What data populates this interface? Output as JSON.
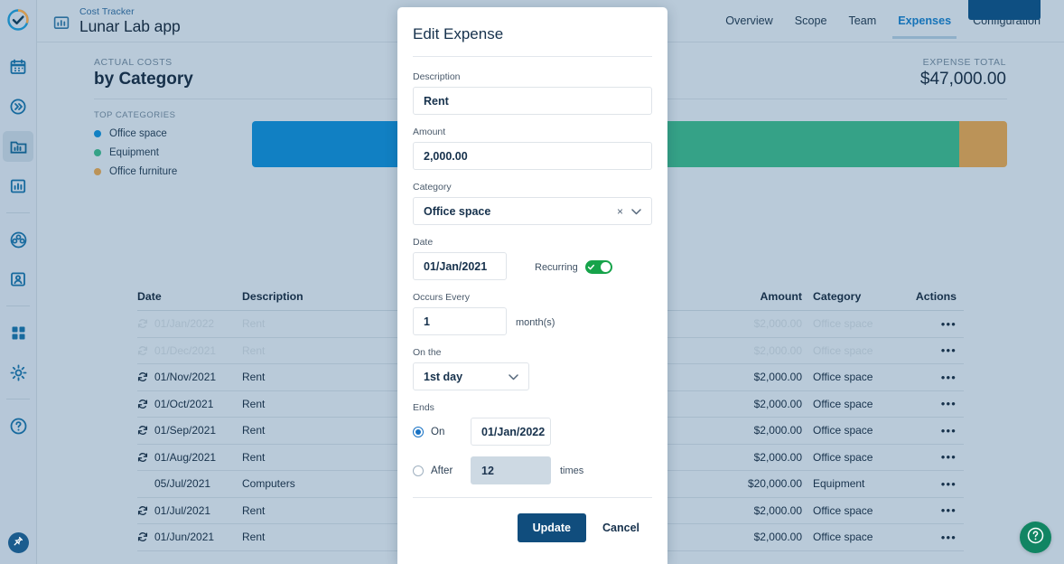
{
  "sidebar": {
    "logo_icon": "check-circle-logo-icon",
    "items": [
      {
        "icon": "calendar-icon",
        "name": "calendar",
        "active": false
      },
      {
        "icon": "chevrons-right-icon",
        "name": "timeline",
        "active": false
      },
      {
        "icon": "folder-chart-icon",
        "name": "projects",
        "active": true
      },
      {
        "icon": "bar-chart-icon",
        "name": "reports",
        "active": false
      },
      {
        "icon": "group-icon",
        "name": "teams",
        "active": false
      },
      {
        "icon": "user-card-icon",
        "name": "resources",
        "active": false
      },
      {
        "icon": "grid-apps-icon",
        "name": "apps",
        "active": false
      },
      {
        "icon": "gear-icon",
        "name": "settings",
        "active": false
      },
      {
        "icon": "question-circle-icon",
        "name": "help",
        "active": false
      }
    ],
    "pin_icon": "pin-icon"
  },
  "header": {
    "app_icon": "chart-folder-icon",
    "breadcrumb": "Cost Tracker",
    "title": "Lunar Lab app",
    "nav": [
      {
        "label": "Overview",
        "active": false
      },
      {
        "label": "Scope",
        "active": false
      },
      {
        "label": "Team",
        "active": false
      },
      {
        "label": "Expenses",
        "active": true
      },
      {
        "label": "Configuration",
        "active": false
      }
    ]
  },
  "chart_panel": {
    "kicker": "ACTUAL COSTS",
    "title": "by Category",
    "total_kicker": "EXPENSE TOTAL",
    "total_value": "$47,000.00",
    "legend_kicker": "TOP CATEGORIES"
  },
  "chart_data": {
    "type": "bar",
    "title": "Actual Costs by Category",
    "orientation": "horizontal-stacked",
    "categories": [
      "Office space",
      "Equipment",
      "Office furniture"
    ],
    "values": [
      24000,
      20000,
      3000
    ],
    "colors": [
      "#1180c3",
      "#35a287",
      "#bb9358"
    ],
    "total": 47000,
    "total_label": "$47,000.00",
    "legend_position": "left",
    "grid": false,
    "xlabel": "",
    "ylabel": ""
  },
  "table": {
    "columns": [
      "Date",
      "Description",
      "Amount",
      "Category",
      "Actions"
    ],
    "actions_glyph": "•••",
    "recurring_icon": "recurring-icon",
    "rows": [
      {
        "date": "01/Jan/2022",
        "description": "Rent",
        "amount": "$2,000.00",
        "category": "Office space",
        "recurring": true,
        "dim": true
      },
      {
        "date": "01/Dec/2021",
        "description": "Rent",
        "amount": "$2,000.00",
        "category": "Office space",
        "recurring": true,
        "dim": true
      },
      {
        "date": "01/Nov/2021",
        "description": "Rent",
        "amount": "$2,000.00",
        "category": "Office space",
        "recurring": true,
        "dim": false
      },
      {
        "date": "01/Oct/2021",
        "description": "Rent",
        "amount": "$2,000.00",
        "category": "Office space",
        "recurring": true,
        "dim": false
      },
      {
        "date": "01/Sep/2021",
        "description": "Rent",
        "amount": "$2,000.00",
        "category": "Office space",
        "recurring": true,
        "dim": false
      },
      {
        "date": "01/Aug/2021",
        "description": "Rent",
        "amount": "$2,000.00",
        "category": "Office space",
        "recurring": true,
        "dim": false
      },
      {
        "date": "05/Jul/2021",
        "description": "Computers",
        "amount": "$20,000.00",
        "category": "Equipment",
        "recurring": false,
        "dim": false
      },
      {
        "date": "01/Jul/2021",
        "description": "Rent",
        "amount": "$2,000.00",
        "category": "Office space",
        "recurring": true,
        "dim": false
      },
      {
        "date": "01/Jun/2021",
        "description": "Rent",
        "amount": "$2,000.00",
        "category": "Office space",
        "recurring": true,
        "dim": false
      }
    ]
  },
  "modal": {
    "title": "Edit Expense",
    "description_label": "Description",
    "description_value": "Rent",
    "amount_label": "Amount",
    "amount_value": "2,000.00",
    "category_label": "Category",
    "category_value": "Office space",
    "category_clear_glyph": "×",
    "category_chevron_glyph": "⌄",
    "date_label": "Date",
    "date_value": "01/Jan/2021",
    "recurring_label": "Recurring",
    "recurring_on": true,
    "occurs_label": "Occurs Every",
    "occurs_value": "1",
    "occurs_unit": "month(s)",
    "onthe_label": "On the",
    "onthe_value": "1st day",
    "onthe_chevron_glyph": "⌄",
    "ends_label": "Ends",
    "ends_on_label": "On",
    "ends_on_value": "01/Jan/2022",
    "ends_after_label": "After",
    "ends_after_value": "12",
    "ends_after_unit": "times",
    "ends_selected": "on",
    "update_label": "Update",
    "cancel_label": "Cancel"
  },
  "fab": {
    "icon": "question-circle-icon"
  },
  "colors": {
    "page_bg": "#b9cad9",
    "accent_blue": "#1673b8",
    "primary_button": "#104d7d",
    "toggle_green": "#16a34a",
    "fab_green": "#118563"
  }
}
